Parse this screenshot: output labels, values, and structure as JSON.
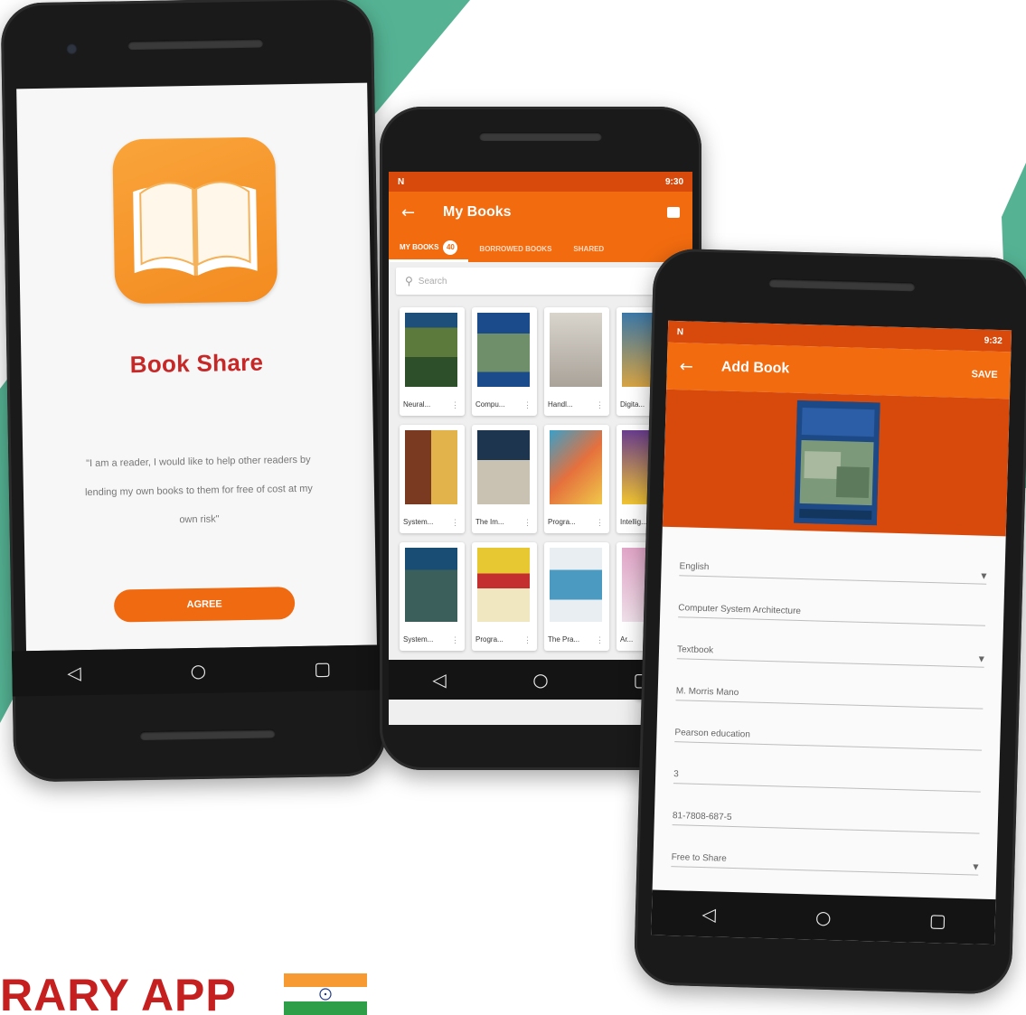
{
  "colors": {
    "accent": "#f26b0f",
    "accent_dark": "#d84a0b",
    "title_red": "#c62828",
    "teal": "#55b394"
  },
  "phone1": {
    "app_title": "Book Share",
    "quote": "\"I am a reader, I would like to help other readers by lending my own books to them for free of cost at my own risk\"",
    "agree_label": "AGREE"
  },
  "phone2": {
    "status_time": "9:30",
    "title": "My Books",
    "tabs": [
      {
        "label": "MY BOOKS",
        "badge": "40"
      },
      {
        "label": "BORROWED BOOKS"
      },
      {
        "label": "SHARED"
      }
    ],
    "search_placeholder": "Search",
    "books": [
      {
        "label": "Neural..."
      },
      {
        "label": "Compu..."
      },
      {
        "label": "Handl..."
      },
      {
        "label": "Digita..."
      },
      {
        "label": "System..."
      },
      {
        "label": "The Im..."
      },
      {
        "label": "Progra..."
      },
      {
        "label": "Intellig..."
      },
      {
        "label": "System..."
      },
      {
        "label": "Progra..."
      },
      {
        "label": "The Pra..."
      },
      {
        "label": "Ar..."
      }
    ]
  },
  "phone3": {
    "status_time": "9:32",
    "title": "Add Book",
    "save_label": "SAVE",
    "fields": [
      {
        "value": "English",
        "dropdown": true
      },
      {
        "value": "Computer System Architecture",
        "dropdown": false
      },
      {
        "value": "Textbook",
        "dropdown": true
      },
      {
        "value": "M. Morris Mano",
        "dropdown": false
      },
      {
        "value": "Pearson education",
        "dropdown": false
      },
      {
        "value": "3",
        "dropdown": false
      },
      {
        "value": "81-7808-687-5",
        "dropdown": false
      },
      {
        "value": "Free to Share",
        "dropdown": true
      }
    ]
  },
  "brand": {
    "text": "RARY APP"
  }
}
